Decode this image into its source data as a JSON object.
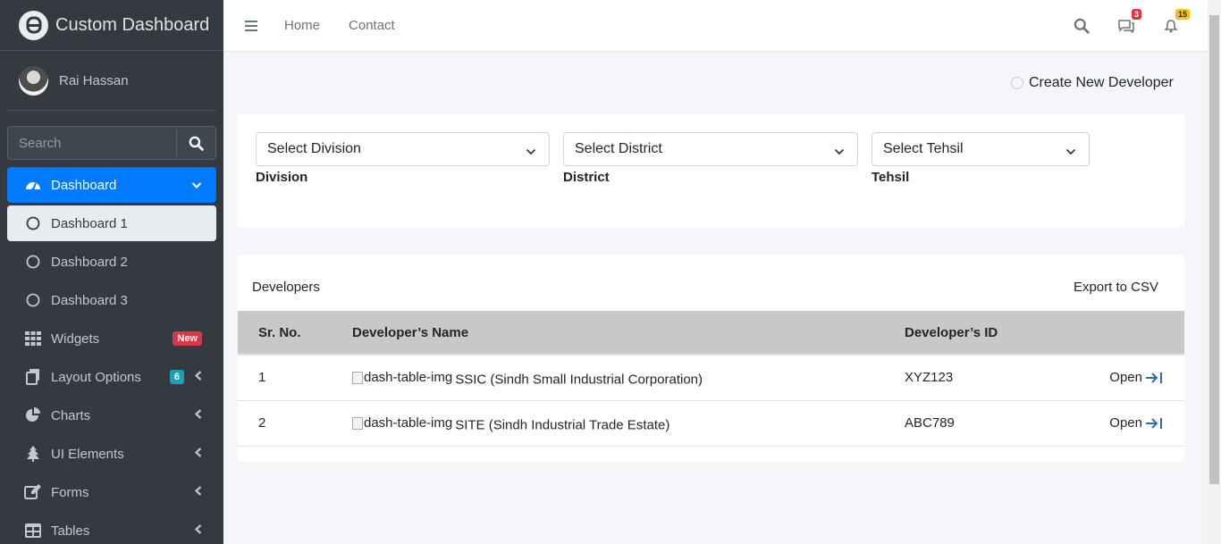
{
  "sidebar": {
    "brand": "Custom Dashboard",
    "user_name": "Rai Hassan",
    "search_placeholder": "Search",
    "nav": {
      "dashboard": "Dashboard",
      "dashboard1": "Dashboard 1",
      "dashboard2": "Dashboard 2",
      "dashboard3": "Dashboard 3",
      "widgets": "Widgets",
      "widgets_badge": "New",
      "layout": "Layout Options",
      "layout_badge": "6",
      "charts": "Charts",
      "ui": "UI Elements",
      "forms": "Forms",
      "tables": "Tables"
    }
  },
  "topbar": {
    "home": "Home",
    "contact": "Contact",
    "messages_count": "3",
    "notifications_count": "15"
  },
  "content": {
    "create_link": "Create New Developer",
    "filters": {
      "division_select": "Select Division",
      "division_label": "Division",
      "district_select": "Select District",
      "district_label": "District",
      "tehsil_select": "Select Tehsil",
      "tehsil_label": "Tehsil"
    },
    "table": {
      "title": "Developers",
      "export": "Export to CSV",
      "headers": [
        "Sr. No.",
        "Developer’s Name",
        "Developer’s ID"
      ],
      "rows": [
        {
          "sr": "1",
          "img_alt": "dash-table-img",
          "name": "SSIC (Sindh Small Industrial Corporation)",
          "id": "XYZ123",
          "action": "Open"
        },
        {
          "sr": "2",
          "img_alt": "dash-table-img",
          "name": "SITE (Sindh Industrial Trade Estate)",
          "id": "ABC789",
          "action": "Open"
        }
      ]
    }
  },
  "colors": {
    "sidebar_bg": "#343a40",
    "active_blue": "#007bff",
    "badge_red": "#dc3545",
    "badge_teal": "#17a2b8",
    "badge_yellow": "#ffc107",
    "table_header_bg": "#c8c8c8"
  }
}
